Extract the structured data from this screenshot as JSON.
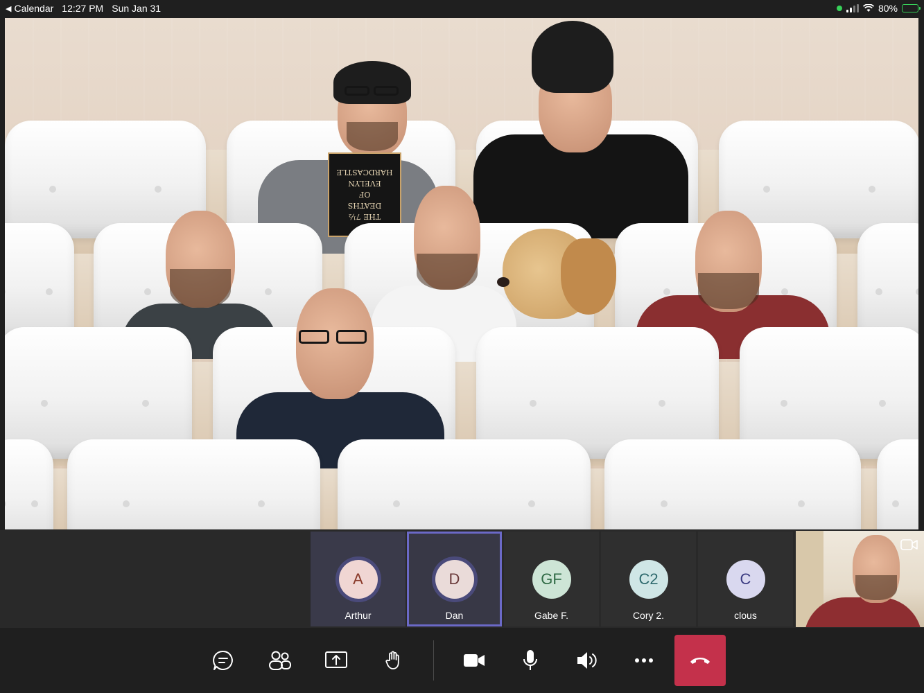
{
  "status_bar": {
    "back_app": "Calendar",
    "time": "12:27 PM",
    "date": "Sun Jan 31",
    "battery": "80%",
    "battery_level": 0.8,
    "accent_green": "#37d159"
  },
  "stage": {
    "book": {
      "line1": "THE 7½",
      "line2": "DEATHS",
      "line3": "OF",
      "line4": "EVELYN",
      "line5": "HARDCASTLE"
    }
  },
  "participants": [
    {
      "initials": "A",
      "name": "Arthur",
      "avatar_bg": "#f0d6d3",
      "avatar_fg": "#8a3a2a",
      "ring": true,
      "active": true
    },
    {
      "initials": "D",
      "name": "Dan",
      "avatar_bg": "#eadbd9",
      "avatar_fg": "#6a3a3a",
      "ring": true,
      "selected": true
    },
    {
      "initials": "GF",
      "name": "Gabe F.",
      "avatar_bg": "#cde5d6",
      "avatar_fg": "#2f6a45",
      "ring": false
    },
    {
      "initials": "C2",
      "name": "Cory 2.",
      "avatar_bg": "#cfe6e6",
      "avatar_fg": "#2e6a6e",
      "ring": false
    },
    {
      "initials": "C",
      "name": "clous",
      "avatar_bg": "#d9d8ef",
      "avatar_fg": "#3a3a80",
      "ring": false
    }
  ],
  "self_view": {
    "icon": "camera-switch-icon"
  },
  "controls": {
    "buttons": [
      {
        "name": "chat-button",
        "icon": "chat-icon"
      },
      {
        "name": "participants-button",
        "icon": "people-icon"
      },
      {
        "name": "share-button",
        "icon": "share-screen-icon"
      },
      {
        "name": "raise-hand-button",
        "icon": "hand-icon"
      },
      {
        "name": "camera-button",
        "icon": "video-camera-icon"
      },
      {
        "name": "mic-button",
        "icon": "microphone-icon"
      },
      {
        "name": "speaker-button",
        "icon": "speaker-icon"
      },
      {
        "name": "more-button",
        "icon": "more-icon"
      }
    ],
    "hangup": {
      "icon": "hang-up-icon",
      "color": "#c4314b"
    }
  }
}
